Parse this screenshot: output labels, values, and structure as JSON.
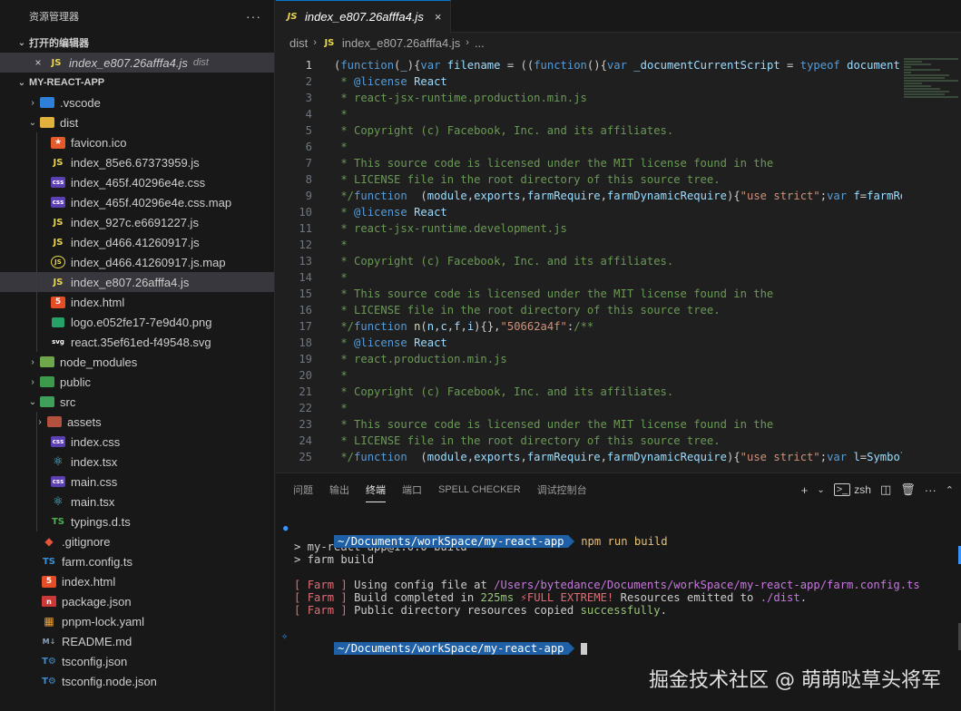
{
  "sidebar": {
    "title": "资源管理器",
    "more": "···",
    "open_editors_label": "打开的编辑器",
    "open_editor": {
      "name": "index_e807.26afffa4.js",
      "dir": "dist"
    },
    "project_label": "MY-REACT-APP",
    "tree": [
      {
        "label": ".vscode",
        "kind": "folder"
      },
      {
        "label": "dist",
        "kind": "folder"
      },
      {
        "label": "favicon.ico"
      },
      {
        "label": "index_85e6.67373959.js"
      },
      {
        "label": "index_465f.40296e4e.css"
      },
      {
        "label": "index_465f.40296e4e.css.map"
      },
      {
        "label": "index_927c.e6691227.js"
      },
      {
        "label": "index_d466.41260917.js"
      },
      {
        "label": "index_d466.41260917.js.map"
      },
      {
        "label": "index_e807.26afffa4.js"
      },
      {
        "label": "index.html"
      },
      {
        "label": "logo.e052fe17-7e9d40.png"
      },
      {
        "label": "react.35ef61ed-f49548.svg"
      },
      {
        "label": "node_modules",
        "kind": "folder"
      },
      {
        "label": "public",
        "kind": "folder"
      },
      {
        "label": "src",
        "kind": "folder"
      },
      {
        "label": "assets",
        "kind": "folder"
      },
      {
        "label": "index.css"
      },
      {
        "label": "index.tsx"
      },
      {
        "label": "main.css"
      },
      {
        "label": "main.tsx"
      },
      {
        "label": "typings.d.ts"
      },
      {
        "label": ".gitignore"
      },
      {
        "label": "farm.config.ts"
      },
      {
        "label": "index.html"
      },
      {
        "label": "package.json"
      },
      {
        "label": "pnpm-lock.yaml"
      },
      {
        "label": "README.md"
      },
      {
        "label": "tsconfig.json"
      },
      {
        "label": "tsconfig.node.json"
      }
    ]
  },
  "editor": {
    "tab_label": "index_e807.26afffa4.js",
    "tab_icon": "JS",
    "breadcrumb": {
      "dir": "dist",
      "file": "index_e807.26afffa4.js",
      "more": "..."
    },
    "line_numbers": [
      "1",
      "2",
      "3",
      "4",
      "5",
      "6",
      "7",
      "8",
      "9",
      "10",
      "11",
      "12",
      "13",
      "14",
      "15",
      "16",
      "17",
      "18",
      "19",
      "20",
      "21",
      "22",
      "23",
      "24",
      "25"
    ]
  },
  "panel": {
    "tabs": [
      "问题",
      "输出",
      "终端",
      "端口",
      "SPELL CHECKER",
      "调试控制台"
    ],
    "shell": "zsh",
    "prompt_path": "~/Documents/workSpace/my-react-app",
    "command": "npm run build",
    "out1": "> my-react-app@1.0.0 build",
    "out2": "> farm build",
    "farm_tag": "Farm",
    "l1_text": "Using config file at ",
    "l1_path": "/Users/bytedance/Documents/workSpace/my-react-app/farm.config.ts",
    "l2_text": "Build completed in ",
    "l2_ms": "225ms",
    "l2_extreme": "⚡FULL EXTREME!",
    "l2_rest": " Resources emitted to ",
    "l2_dist": "./dist",
    "l2_end": ".",
    "l3_text": "Public directory resources copied ",
    "l3_ok": "successfully",
    "l3_end": "."
  },
  "watermark": "掘金技术社区 @ 萌萌哒草头将军"
}
